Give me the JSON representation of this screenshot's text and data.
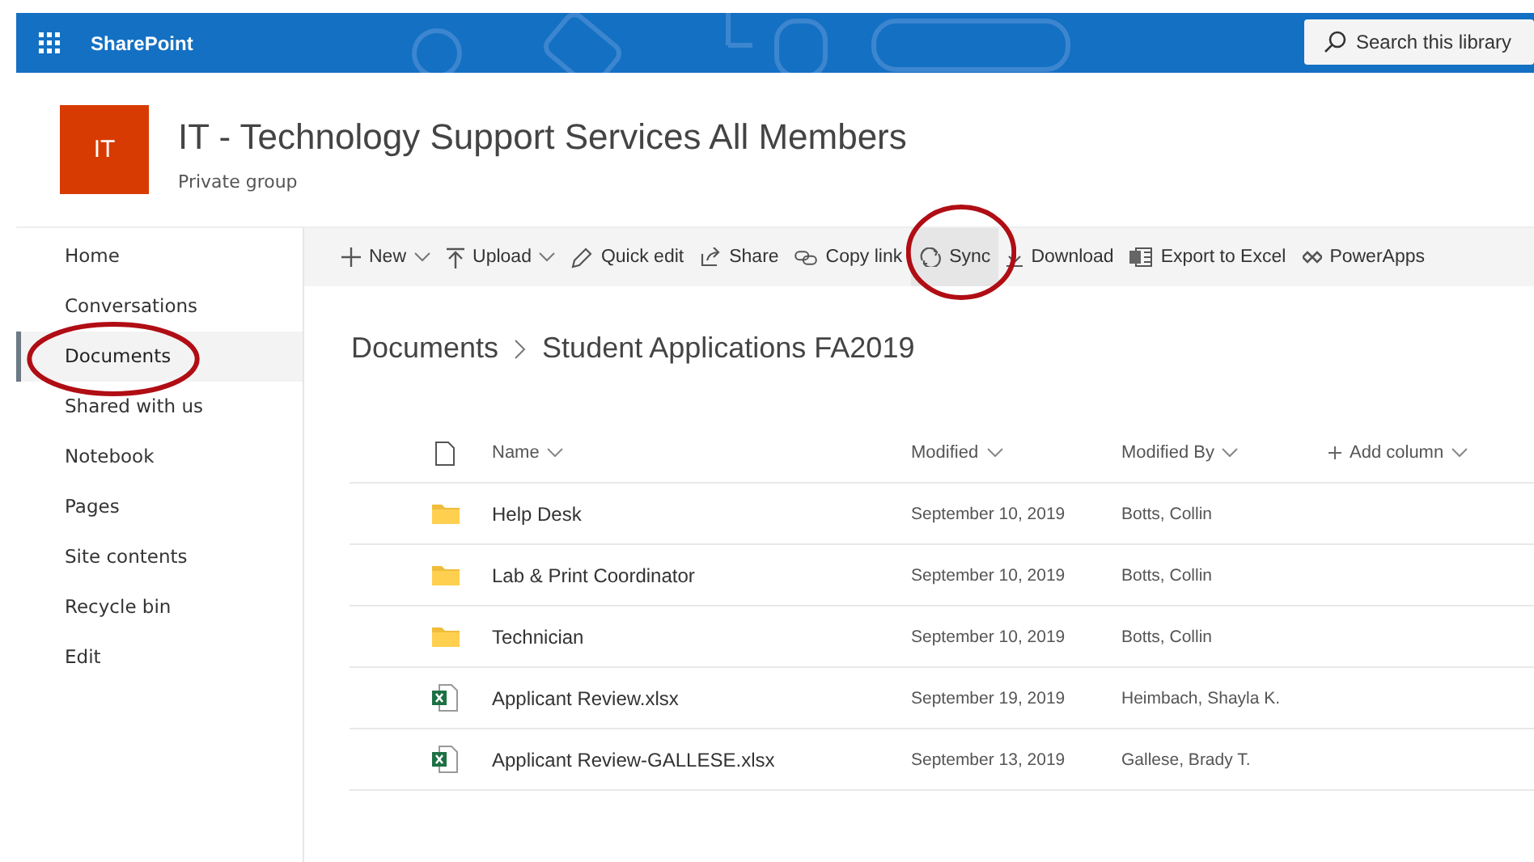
{
  "topbar": {
    "app_name": "SharePoint",
    "search": {
      "placeholder": "Search this library"
    }
  },
  "site": {
    "logo": "IT",
    "title": "IT - Technology Support Services All Members",
    "subtitle": "Private group"
  },
  "nav": [
    {
      "label": "Home",
      "selected": false
    },
    {
      "label": "Conversations",
      "selected": false
    },
    {
      "label": "Documents",
      "selected": true
    },
    {
      "label": "Shared with us",
      "selected": false
    },
    {
      "label": "Notebook",
      "selected": false
    },
    {
      "label": "Pages",
      "selected": false
    },
    {
      "label": "Site contents",
      "selected": false
    },
    {
      "label": "Recycle bin",
      "selected": false
    },
    {
      "label": "Edit",
      "selected": false
    }
  ],
  "toolbar": [
    {
      "kind": "new",
      "label": "New",
      "dropdown": true,
      "selected": false
    },
    {
      "kind": "upload",
      "label": "Upload",
      "dropdown": true,
      "selected": false
    },
    {
      "kind": "edit",
      "label": "Quick edit",
      "dropdown": false,
      "selected": false
    },
    {
      "kind": "share",
      "label": "Share",
      "dropdown": false,
      "selected": false
    },
    {
      "kind": "link",
      "label": "Copy link",
      "dropdown": false,
      "selected": false
    },
    {
      "kind": "sync",
      "label": "Sync",
      "dropdown": false,
      "selected": true
    },
    {
      "kind": "download",
      "label": "Download",
      "dropdown": false,
      "selected": false
    },
    {
      "kind": "excel",
      "label": "Export to Excel",
      "dropdown": false,
      "selected": false
    },
    {
      "kind": "powerapps",
      "label": "PowerApps",
      "dropdown": false,
      "selected": false
    }
  ],
  "breadcrumb": [
    "Documents",
    "Student Applications FA2019"
  ],
  "table": {
    "columns": [
      "Name",
      "Modified",
      "Modified By",
      "Add column"
    ],
    "rows": [
      {
        "kind": "folder",
        "name": "Help Desk",
        "modified": "September 10, 2019",
        "modified_by": "Botts, Collin"
      },
      {
        "kind": "folder",
        "name": "Lab & Print Coordinator",
        "modified": "September 10, 2019",
        "modified_by": "Botts, Collin"
      },
      {
        "kind": "folder",
        "name": "Technician",
        "modified": "September 10, 2019",
        "modified_by": "Botts, Collin"
      },
      {
        "kind": "excel",
        "name": "Applicant Review.xlsx",
        "modified": "September 19, 2019",
        "modified_by": "Heimbach, Shayla K."
      },
      {
        "kind": "excel",
        "name": "Applicant Review-GALLESE.xlsx",
        "modified": "September 13, 2019",
        "modified_by": "Gallese, Brady T."
      }
    ]
  },
  "annotations": [
    {
      "kind": "circle"
    },
    {
      "kind": "circle"
    }
  ]
}
